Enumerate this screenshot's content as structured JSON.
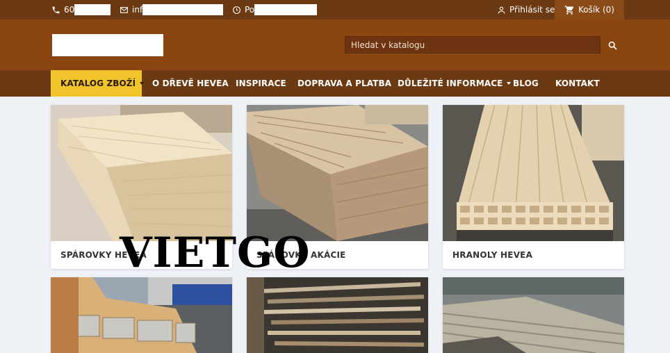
{
  "topbar": {
    "phone_prefix": "60",
    "email_prefix": "inf",
    "hours_prefix": "Po",
    "login_label": "Přihlásit se",
    "cart_label": "Košík (0)"
  },
  "search": {
    "placeholder": "Hledat v katalogu"
  },
  "nav": {
    "items": [
      {
        "label": "KATALOG ZBOŽÍ"
      },
      {
        "label": "O DŘEVĚ HEVEA"
      },
      {
        "label": "INSPIRACE"
      },
      {
        "label": "DOPRAVA A PLATBA"
      },
      {
        "label": "DŮLEŽITÉ INFORMACE"
      },
      {
        "label": "BLOG"
      },
      {
        "label": "KONTAKT"
      }
    ]
  },
  "products": [
    {
      "title": "SPÁROVKY HEVEA"
    },
    {
      "title": "SPÁROVKY AKÁCIE"
    },
    {
      "title": "HRANOLY HEVEA"
    }
  ],
  "watermark": "VIETGO",
  "colors": {
    "topbar": "#6b3a12",
    "header": "#8b4510",
    "nav_active": "#f0c42a",
    "page_background": "#eef1f5"
  }
}
